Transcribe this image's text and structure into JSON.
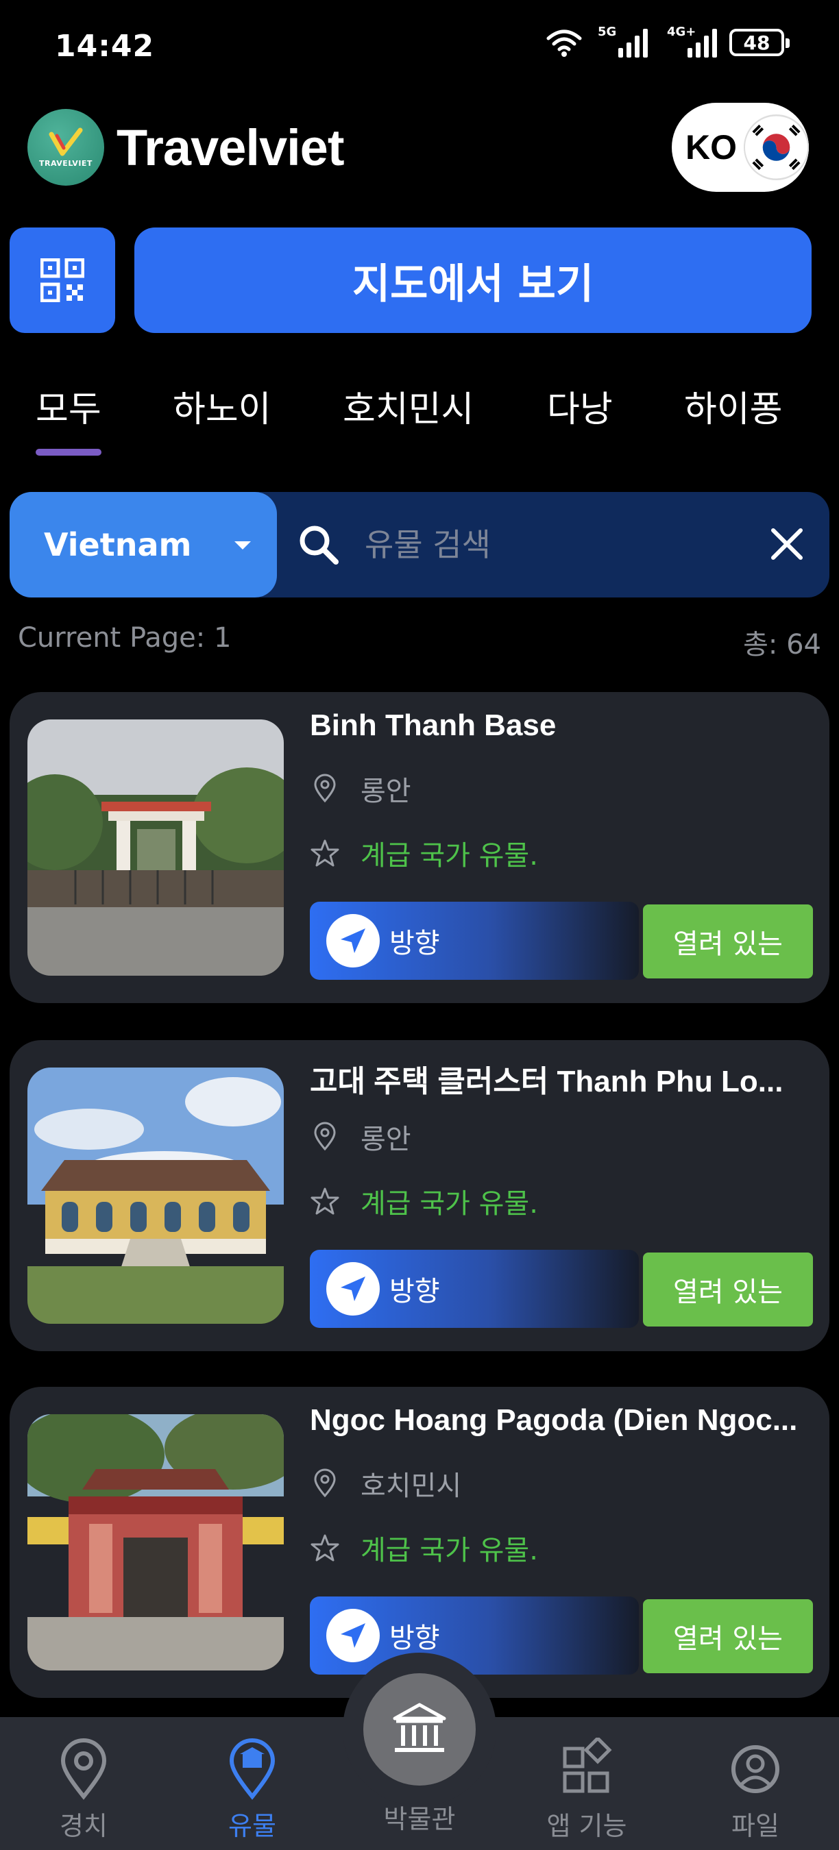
{
  "status_bar": {
    "time": "14:42",
    "network_1": "5G",
    "network_2": "4G+",
    "battery": "48"
  },
  "header": {
    "app_title": "Travelviet",
    "logo_text": "TRAVELVIET",
    "language": "KO"
  },
  "actions": {
    "map_view_label": "지도에서 보기"
  },
  "tabs": [
    {
      "label": "모두",
      "active": true
    },
    {
      "label": "하노이"
    },
    {
      "label": "호치민시"
    },
    {
      "label": "다낭"
    },
    {
      "label": "하이퐁"
    }
  ],
  "search": {
    "country": "Vietnam",
    "placeholder": "유물 검색"
  },
  "page_meta": {
    "current_page": "Current Page: 1",
    "total": "총: 64"
  },
  "relics": [
    {
      "title": "Binh Thanh Base",
      "location": "롱안",
      "rank": "계급 국가 유물.",
      "direction_label": "방향",
      "status_label": "열려 있는"
    },
    {
      "title": "고대 주택 클러스터 Thanh Phu Lo...",
      "location": "롱안",
      "rank": "계급 국가 유물.",
      "direction_label": "방향",
      "status_label": "열려 있는"
    },
    {
      "title": "Ngoc Hoang Pagoda (Dien Ngoc...",
      "location": "호치민시",
      "rank": "계급 국가 유물.",
      "direction_label": "방향",
      "status_label": "열려 있는"
    }
  ],
  "bottom_nav": {
    "scenery": "경치",
    "relics": "유물",
    "museum": "박물관",
    "app_features": "앱 기능",
    "files": "파일"
  },
  "colors": {
    "primary_blue": "#2e6ef2",
    "select_blue": "#3b86ec",
    "open_green": "#6abf4b",
    "rank_green": "#4ec24a",
    "active_nav": "#3d7ff0",
    "tab_indicator": "#7b5cc4"
  }
}
